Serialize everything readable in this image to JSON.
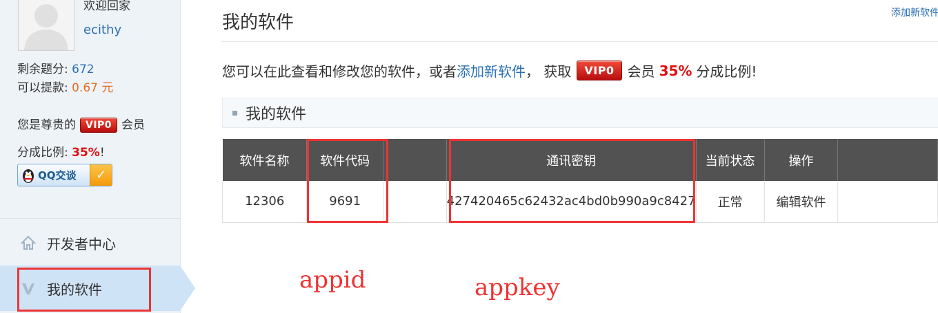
{
  "sidebar": {
    "welcome": "欢迎回家",
    "username": "ecithy",
    "balance_label": "剩余题分:",
    "balance_value": "672",
    "withdraw_label": "可以提款:",
    "withdraw_value": "0.67 元",
    "vip_prefix": "您是尊贵的",
    "vip_badge": "VIP0",
    "vip_suffix": "会员",
    "share_label": "分成比例:",
    "share_value": "35%",
    "share_suffix": "!",
    "qq_button": "QQ交谈",
    "nav": [
      {
        "label": "开发者中心",
        "icon": "home-icon"
      },
      {
        "label": "我的软件",
        "icon": "v-icon",
        "active": true
      }
    ]
  },
  "header": {
    "title": "我的软件",
    "top_link": "添加新软件"
  },
  "intro": {
    "text_1": "您可以在此查看和修改您的软件，或者",
    "link": "添加新软件",
    "text_2": "， 获取",
    "vip_badge": "VIP0",
    "text_3": "会员",
    "percent": "35%",
    "text_4": "分成比例!"
  },
  "section": {
    "title": "我的软件"
  },
  "table": {
    "headers": [
      "软件名称",
      "软件代码",
      "",
      "通讯密钥",
      "当前状态",
      "操作"
    ],
    "rows": [
      {
        "name": "12306",
        "code": "9691",
        "key": "427420465c62432ac4bd0b990a9c8427",
        "status": "正常",
        "action": "编辑软件"
      }
    ]
  },
  "annotations": {
    "appid": "appid",
    "appkey": "appkey",
    "highlight_color": "#ee3333"
  },
  "colors": {
    "link": "#2a6fb4",
    "accent_red": "#e01010",
    "table_header": "#525252",
    "status_ok": "#2e8b2e",
    "sidebar_bg": "#eef3f8",
    "nav_active": "#cfe3f7"
  }
}
